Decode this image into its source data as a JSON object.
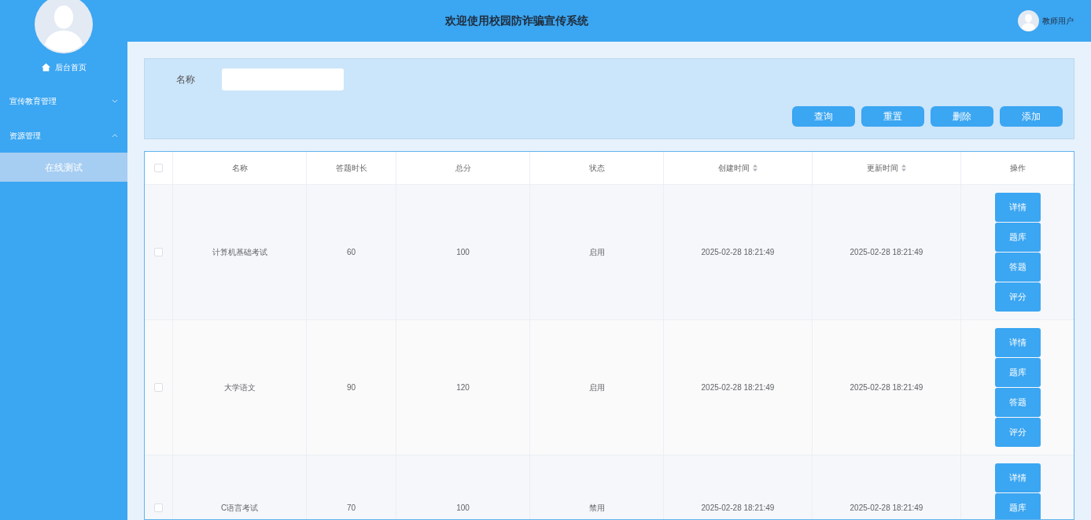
{
  "header": {
    "title": "欢迎使用校园防诈骗宣传系统",
    "user": "教师用户"
  },
  "sidebar": {
    "home": "后台首页",
    "menus": [
      {
        "label": "宣传教育管理",
        "expanded": false
      },
      {
        "label": "资源管理",
        "expanded": true,
        "children": [
          {
            "label": "在线测试",
            "selected": true
          }
        ]
      }
    ]
  },
  "search": {
    "label": "名称",
    "buttons": [
      "查询",
      "重置",
      "删除",
      "添加"
    ]
  },
  "table": {
    "select_all": {
      "checked": false
    },
    "columns": [
      {
        "label": "名称",
        "sortable": false
      },
      {
        "label": "答题时长",
        "sortable": false
      },
      {
        "label": "总分",
        "sortable": false
      },
      {
        "label": "状态",
        "sortable": false
      },
      {
        "label": "创建时间",
        "sortable": true
      },
      {
        "label": "更新时间",
        "sortable": true
      },
      {
        "label": "操作",
        "sortable": false
      }
    ],
    "rows": [
      {
        "checked": false,
        "cells": [
          "计算机基础考试",
          "60",
          "100",
          "启用",
          "2025-02-28 18:21:49",
          "2025-02-28 18:21:49"
        ],
        "actions": [
          "详情",
          "题库",
          "答题",
          "评分"
        ]
      },
      {
        "checked": false,
        "cells": [
          "大学语文",
          "90",
          "120",
          "启用",
          "2025-02-28 18:21:49",
          "2025-02-28 18:21:49"
        ],
        "actions": [
          "详情",
          "题库",
          "答题",
          "评分"
        ]
      },
      {
        "checked": false,
        "cells": [
          "C语言考试",
          "70",
          "100",
          "禁用",
          "2025-02-28 18:21:49",
          "2025-02-28 18:21:49"
        ],
        "actions": [
          "详情",
          "题库"
        ]
      }
    ]
  }
}
